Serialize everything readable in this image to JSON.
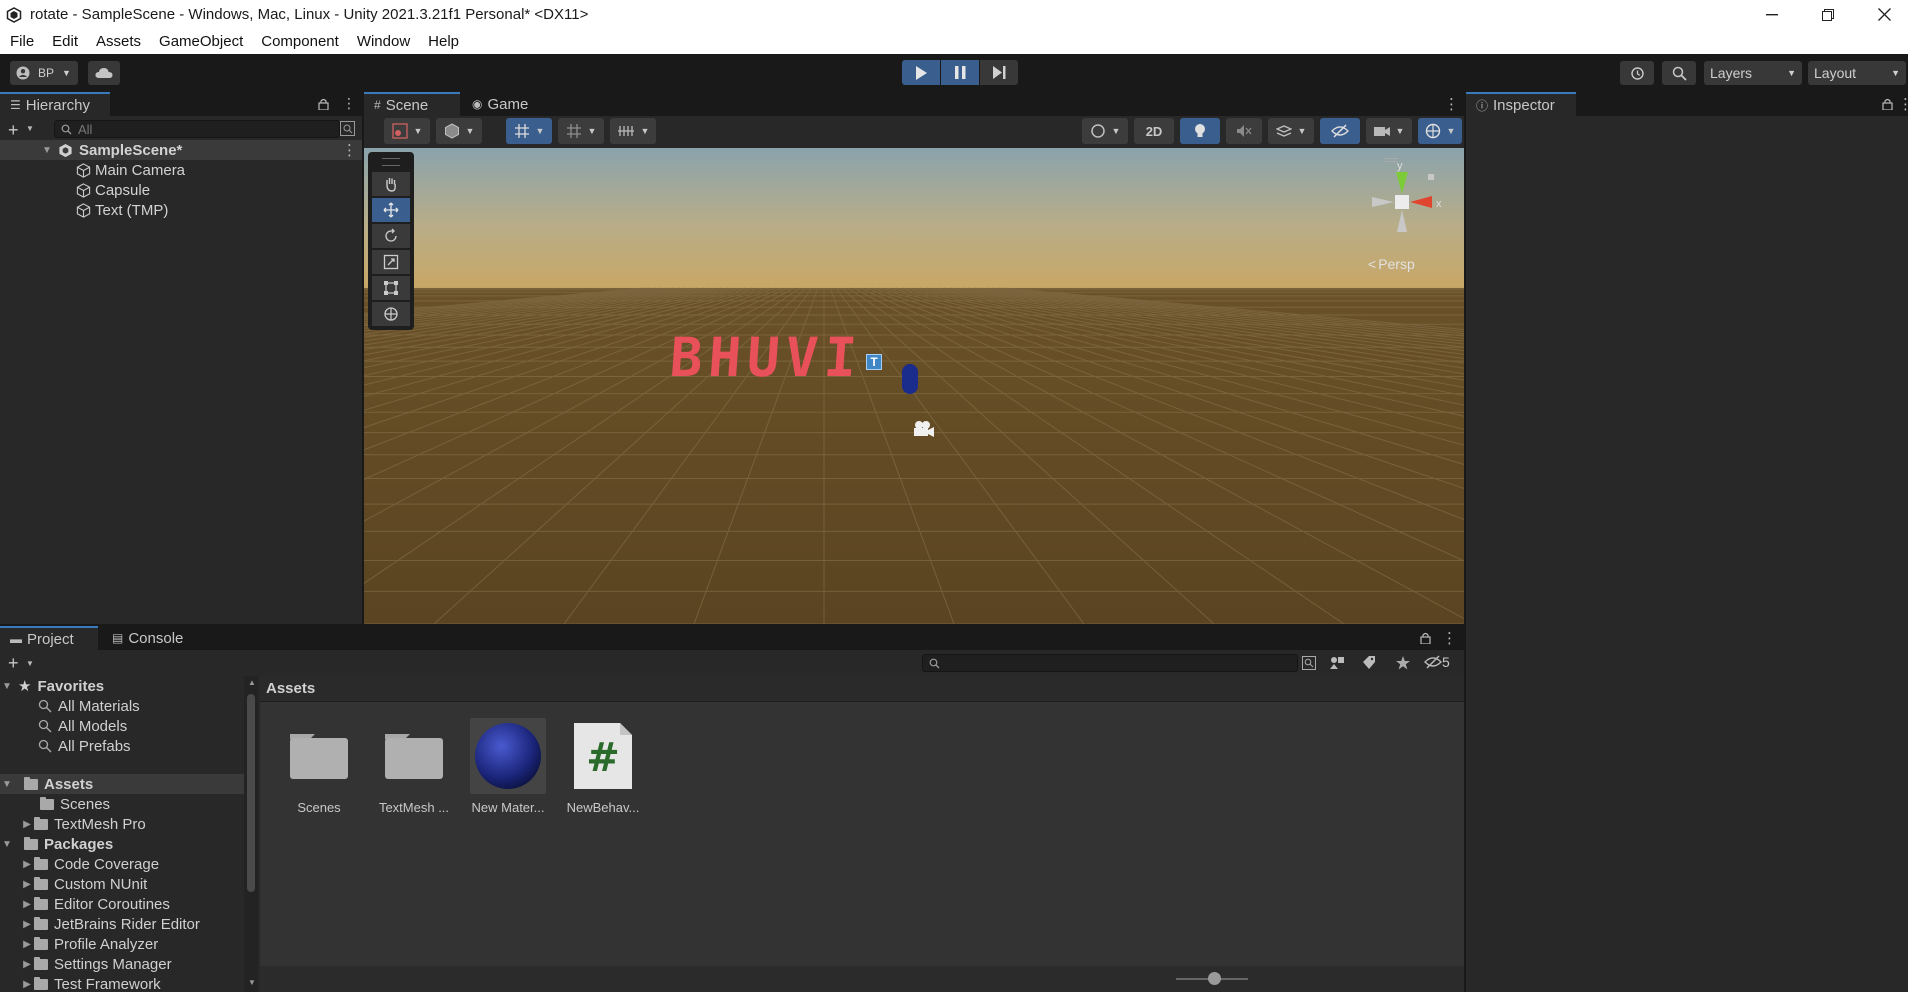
{
  "window": {
    "title": "rotate - SampleScene - Windows, Mac, Linux - Unity 2021.3.21f1 Personal* <DX11>"
  },
  "menu": [
    "File",
    "Edit",
    "Assets",
    "GameObject",
    "Component",
    "Window",
    "Help"
  ],
  "toolbar": {
    "account_label": "BP",
    "layers_label": "Layers",
    "layout_label": "Layout"
  },
  "hierarchy": {
    "tab_label": "Hierarchy",
    "search_placeholder": "All",
    "scene_name": "SampleScene*",
    "objects": [
      "Main Camera",
      "Capsule",
      "Text (TMP)"
    ]
  },
  "scene_view": {
    "tabs": [
      "Scene",
      "Game"
    ],
    "mode_2d_label": "2D",
    "projection_label": "Persp",
    "world_text": "BHUVI",
    "axis_labels": {
      "x": "x",
      "y": "y"
    }
  },
  "inspector": {
    "tab_label": "Inspector"
  },
  "project": {
    "tabs": [
      "Project",
      "Console"
    ],
    "hidden_count": "5",
    "breadcrumb": "Assets",
    "favorites": {
      "label": "Favorites",
      "items": [
        "All Materials",
        "All Models",
        "All Prefabs"
      ]
    },
    "assets_root": {
      "label": "Assets",
      "items": [
        "Scenes",
        "TextMesh Pro"
      ]
    },
    "packages": {
      "label": "Packages",
      "items": [
        "Code Coverage",
        "Custom NUnit",
        "Editor Coroutines",
        "JetBrains Rider Editor",
        "Profile Analyzer",
        "Settings Manager",
        "Test Framework"
      ]
    },
    "grid_items": [
      {
        "label": "Scenes",
        "kind": "folder"
      },
      {
        "label": "TextMesh ...",
        "kind": "folder"
      },
      {
        "label": "New Mater...",
        "kind": "material"
      },
      {
        "label": "NewBehav...",
        "kind": "script"
      }
    ]
  },
  "colors": {
    "accent": "#3a79bb",
    "play_active": "#3a5f8f",
    "world_text": "#e8505a",
    "capsule": "#1a2c8c"
  }
}
